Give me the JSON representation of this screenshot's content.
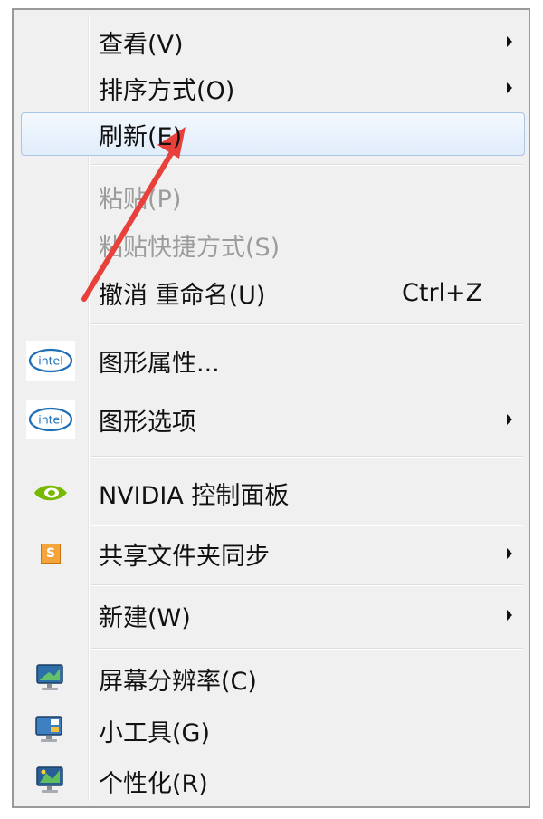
{
  "menu": {
    "items": [
      {
        "label": "查看(V)",
        "submenu": true
      },
      {
        "label": "排序方式(O)",
        "submenu": true
      },
      {
        "label": "刷新(E)",
        "highlighted": true
      },
      {
        "label": "粘贴(P)",
        "disabled": true
      },
      {
        "label": "粘贴快捷方式(S)",
        "disabled": true
      },
      {
        "label": "撤消 重命名(U)",
        "shortcut": "Ctrl+Z"
      },
      {
        "label": "图形属性...",
        "icon": "intel-icon"
      },
      {
        "label": "图形选项",
        "icon": "intel-icon",
        "submenu": true
      },
      {
        "label": "NVIDIA 控制面板",
        "icon": "nvidia-icon"
      },
      {
        "label": "共享文件夹同步",
        "icon": "sync-s-icon",
        "submenu": true
      },
      {
        "label": "新建(W)",
        "submenu": true
      },
      {
        "label": "屏幕分辨率(C)",
        "icon": "monitor-icon"
      },
      {
        "label": "小工具(G)",
        "icon": "gadgets-icon"
      },
      {
        "label": "个性化(R)",
        "icon": "personalize-icon"
      }
    ]
  },
  "icons": {
    "intel_text": "intel",
    "sync_letter": "S"
  },
  "colors": {
    "highlight_border": "#a8c5e6",
    "annotation_arrow": "#e8403a",
    "disabled_text": "#9c9c9c"
  }
}
